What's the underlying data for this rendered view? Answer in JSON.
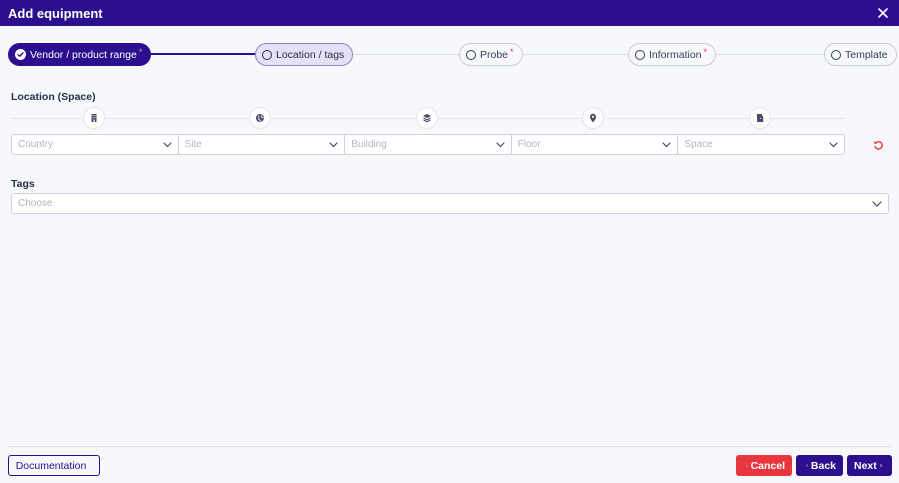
{
  "window": {
    "title": "Add equipment",
    "close_icon": "close-icon"
  },
  "stepper": {
    "steps": [
      {
        "label": "Vendor / product range",
        "required": "*",
        "state": "completed"
      },
      {
        "label": "Location / tags",
        "required": "",
        "state": "current"
      },
      {
        "label": "Probe",
        "required": "*",
        "state": "pending"
      },
      {
        "label": "Information",
        "required": "*",
        "state": "pending"
      },
      {
        "label": "Template",
        "required": "",
        "state": "pending"
      }
    ]
  },
  "location": {
    "label": "Location (Space)",
    "icons": [
      "building-icon",
      "globe-icon",
      "layers-icon",
      "map-pin-icon",
      "door-icon"
    ],
    "fields": [
      {
        "placeholder": "Country"
      },
      {
        "placeholder": "Site"
      },
      {
        "placeholder": "Building"
      },
      {
        "placeholder": "Floor"
      },
      {
        "placeholder": "Space"
      }
    ],
    "reset_icon": "reset-icon"
  },
  "tags": {
    "label": "Tags",
    "placeholder": "Choose"
  },
  "footer": {
    "documentation_label": "Documentation",
    "cancel_label": "Cancel",
    "back_label": "Back",
    "next_label": "Next"
  },
  "colors": {
    "primary": "#2c0f8f",
    "danger": "#e8363f",
    "required": "#e23b3b"
  }
}
